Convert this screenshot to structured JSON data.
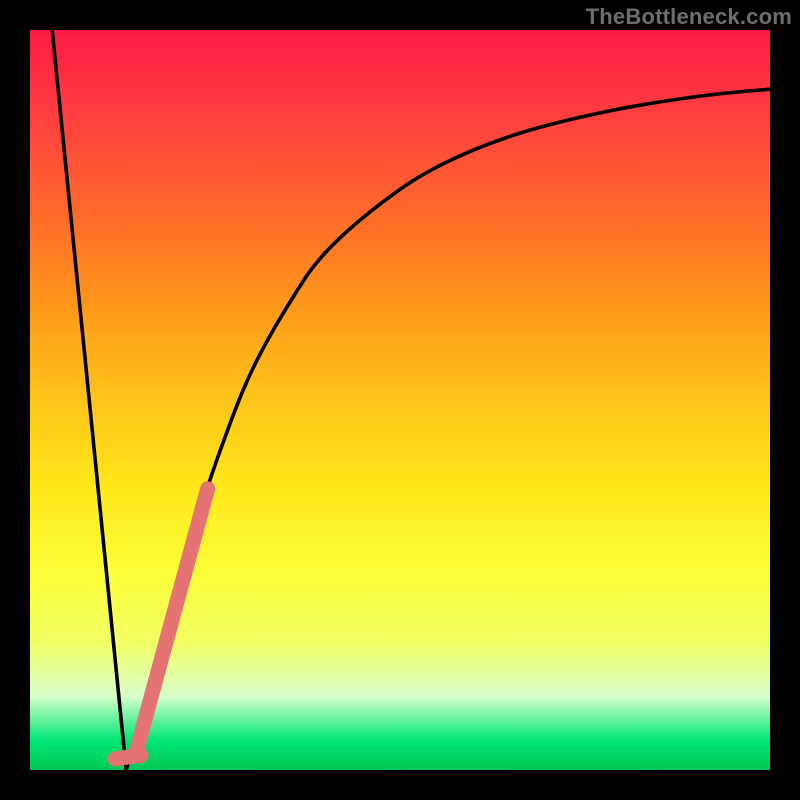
{
  "watermark": "TheBottleneck.com",
  "colors": {
    "frame": "#000000",
    "curve": "#000000",
    "highlight": "#e57373",
    "gradient_top": "#ff1a44",
    "gradient_bottom": "#00c853"
  },
  "chart_data": {
    "type": "line",
    "title": "",
    "xlabel": "",
    "ylabel": "",
    "xlim": [
      0,
      100
    ],
    "ylim": [
      0,
      100
    ],
    "grid": false,
    "legend": false,
    "series": [
      {
        "name": "left-falling-line",
        "x": [
          3,
          13
        ],
        "values": [
          100,
          0
        ]
      },
      {
        "name": "right-rising-curve",
        "x": [
          13,
          18,
          22,
          26,
          30,
          35,
          40,
          48,
          56,
          66,
          78,
          90,
          100
        ],
        "values": [
          0,
          18,
          32,
          44,
          54,
          63,
          70,
          77,
          82,
          86,
          89,
          91,
          92
        ]
      },
      {
        "name": "highlight-segment",
        "x": [
          14.5,
          24
        ],
        "values": [
          3,
          38
        ]
      },
      {
        "name": "highlight-nub",
        "x": [
          11.5,
          15
        ],
        "values": [
          1.5,
          2
        ]
      }
    ]
  }
}
